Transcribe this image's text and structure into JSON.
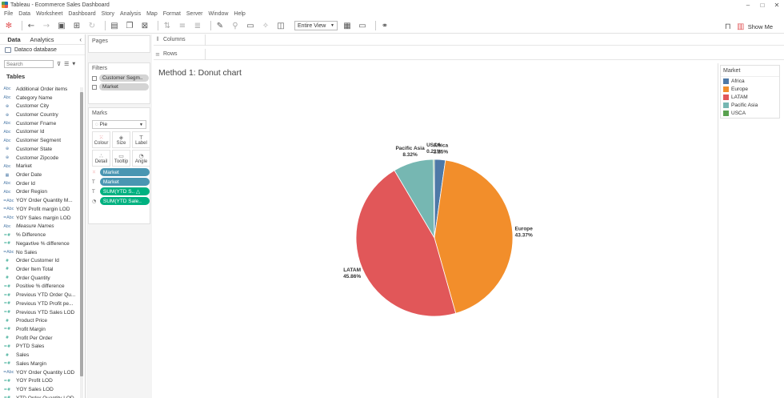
{
  "window": {
    "title": "Tableau - Ecommerce Sales Dashboard",
    "controls": [
      "–",
      "□",
      "✕"
    ]
  },
  "menu": [
    "File",
    "Data",
    "Worksheet",
    "Dashboard",
    "Story",
    "Analysis",
    "Map",
    "Format",
    "Server",
    "Window",
    "Help"
  ],
  "toolbar": {
    "view_select": "Entire View",
    "show_me": "Show Me"
  },
  "datapane": {
    "tabs": [
      "Data",
      "Analytics"
    ],
    "datasource": "Dataco database",
    "search_placeholder": "Search",
    "tables_heading": "Tables",
    "fields": [
      {
        "type": "dim-string",
        "icon": "Abc",
        "name": "Additional Order items"
      },
      {
        "type": "dim-string",
        "icon": "Abc",
        "name": "Category Name"
      },
      {
        "type": "dim-geo",
        "icon": "⊕",
        "name": "Customer City"
      },
      {
        "type": "dim-geo",
        "icon": "⊕",
        "name": "Customer Country"
      },
      {
        "type": "dim-string",
        "icon": "Abc",
        "name": "Customer Fname"
      },
      {
        "type": "dim-string",
        "icon": "Abc",
        "name": "Customer Id"
      },
      {
        "type": "dim-string",
        "icon": "Abc",
        "name": "Customer Segment"
      },
      {
        "type": "dim-geo",
        "icon": "⊕",
        "name": "Customer State"
      },
      {
        "type": "dim-geo",
        "icon": "⊕",
        "name": "Customer Zipcode"
      },
      {
        "type": "dim-string",
        "icon": "Abc",
        "name": "Market"
      },
      {
        "type": "dim-date",
        "icon": "▦",
        "name": "Order Date"
      },
      {
        "type": "dim-string",
        "icon": "Abc",
        "name": "Order Id"
      },
      {
        "type": "dim-string",
        "icon": "Abc",
        "name": "Order Region"
      },
      {
        "type": "dim-calc",
        "icon": "=Abc",
        "name": "YOY Order Quantity M..."
      },
      {
        "type": "dim-calc",
        "icon": "=Abc",
        "name": "YOY Profit margin LOD"
      },
      {
        "type": "dim-calc",
        "icon": "=Abc",
        "name": "YOY Sales margin LOD"
      },
      {
        "type": "dim-string",
        "icon": "Abc",
        "name": "Measure Names",
        "italic": true
      },
      {
        "type": "measure-calc",
        "icon": "=#",
        "name": "% Difference"
      },
      {
        "type": "measure-calc",
        "icon": "=#",
        "name": "Negavtive % difference"
      },
      {
        "type": "dim-calc",
        "icon": "=Abc",
        "name": "No Sales"
      },
      {
        "type": "measure",
        "icon": "#",
        "name": "Order Customer Id"
      },
      {
        "type": "measure",
        "icon": "#",
        "name": "Order Item Total"
      },
      {
        "type": "measure",
        "icon": "#",
        "name": "Order Quantity"
      },
      {
        "type": "measure-calc",
        "icon": "=#",
        "name": "Positive % difference"
      },
      {
        "type": "measure-calc",
        "icon": "=#",
        "name": "Previous YTD Order Qu..."
      },
      {
        "type": "measure-calc",
        "icon": "=#",
        "name": "Previous YTD Profit pe..."
      },
      {
        "type": "measure-calc",
        "icon": "=#",
        "name": "Previous YTD Sales LOD"
      },
      {
        "type": "measure",
        "icon": "#",
        "name": "Product Price"
      },
      {
        "type": "measure-calc",
        "icon": "=#",
        "name": "Profit Margin"
      },
      {
        "type": "measure",
        "icon": "#",
        "name": "Profit Per Order"
      },
      {
        "type": "measure-calc",
        "icon": "=#",
        "name": "PYTD Sales"
      },
      {
        "type": "measure",
        "icon": "#",
        "name": "Sales"
      },
      {
        "type": "measure-calc",
        "icon": "=#",
        "name": "Sales Margin"
      },
      {
        "type": "dim-calc",
        "icon": "=Abc",
        "name": "YOY Order Quantity LOD"
      },
      {
        "type": "measure-calc",
        "icon": "=#",
        "name": "YOY Profit LOD"
      },
      {
        "type": "measure-calc",
        "icon": "=#",
        "name": "YOY Sales LOD"
      },
      {
        "type": "measure-calc",
        "icon": "=#",
        "name": "YTD Order Quantity LOD"
      }
    ]
  },
  "shelves": {
    "pages_label": "Pages",
    "filters_label": "Filters",
    "filters": [
      "Customer Segm..",
      "Market"
    ],
    "marks_label": "Marks",
    "mark_type": "Pie",
    "mark_buttons": [
      {
        "label": "Colour",
        "icon": "⁙"
      },
      {
        "label": "Size",
        "icon": "◈"
      },
      {
        "label": "Label",
        "icon": "T"
      },
      {
        "label": "Detail",
        "icon": "∴"
      },
      {
        "label": "Tooltip",
        "icon": "▭"
      },
      {
        "label": "Angle",
        "icon": "◔"
      }
    ],
    "mark_fields": [
      {
        "icon": "⁙",
        "label": "Market",
        "kind": "dim"
      },
      {
        "icon": "T",
        "label": "Market",
        "kind": "dim"
      },
      {
        "icon": "T",
        "label": "SUM(YTD S..  △",
        "kind": "meas"
      },
      {
        "icon": "◔",
        "label": "SUM(YTD Sale..",
        "kind": "meas"
      }
    ],
    "columns_label": "Columns",
    "rows_label": "Rows"
  },
  "viz": {
    "title": "Method 1: Donut chart"
  },
  "legend": {
    "title": "Market"
  },
  "chart_data": {
    "type": "pie",
    "title": "Method 1: Donut chart",
    "categories": [
      "Africa",
      "Europe",
      "LATAM",
      "Pacific Asia",
      "USCA"
    ],
    "values": [
      2.25,
      43.37,
      45.86,
      8.32,
      0.21
    ],
    "value_labels": [
      "2.25%",
      "43.37%",
      "45.86%",
      "8.32%",
      "0.21%"
    ],
    "angle_field": "SUM(YTD Sales)",
    "colors": {
      "Africa": "#4e79a7",
      "Europe": "#f28e2b",
      "LATAM": "#e15759",
      "Pacific Asia": "#76b7b2",
      "USCA": "#59a14f"
    },
    "legend_position": "right"
  }
}
